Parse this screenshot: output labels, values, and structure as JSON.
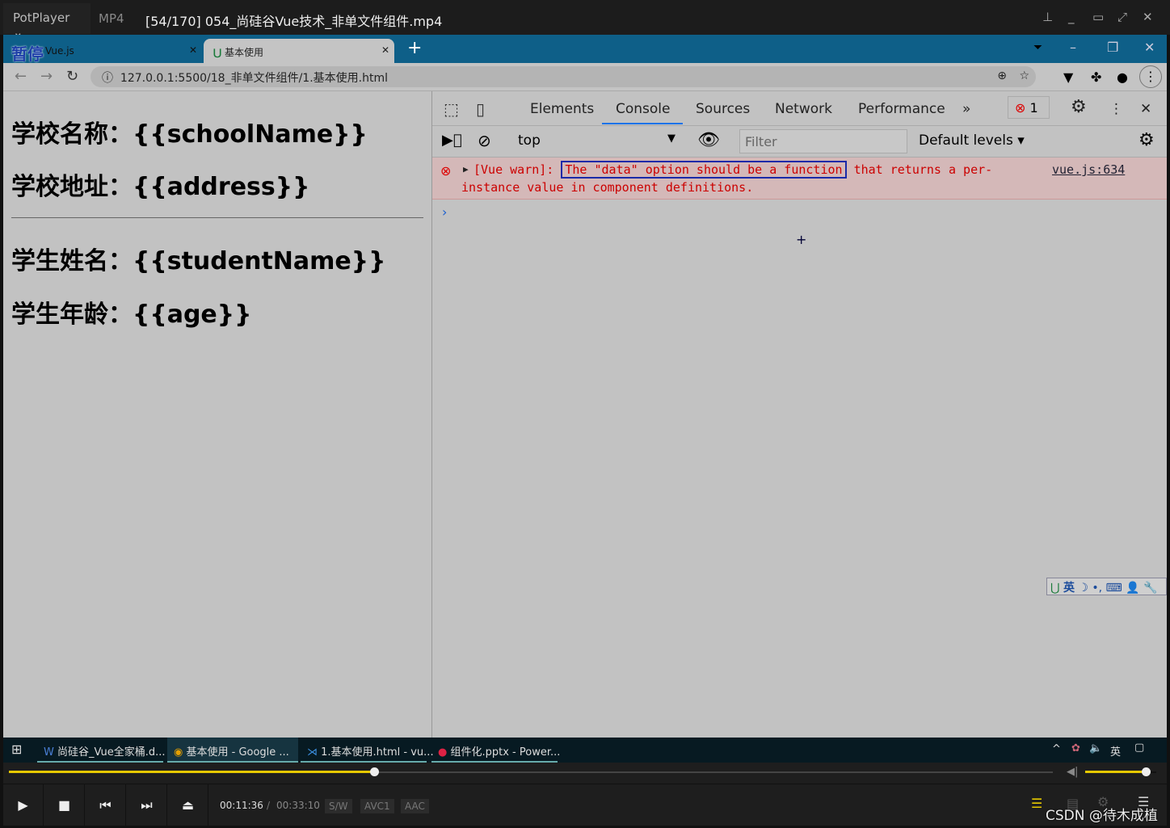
{
  "player": {
    "app": "PotPlayer",
    "format": "MP4",
    "title": "[54/170] 054_尚硅谷Vue技术_非单文件组件.mp4",
    "current_time": "00:11:36",
    "total_time": "00:33:10",
    "chips": [
      "S/W",
      "AVC1",
      "AAC"
    ],
    "progress_percent": 35,
    "volume_percent": 85,
    "watermark": "CSDN @待木成植",
    "paused_label": "暂停"
  },
  "browser": {
    "tabs": [
      {
        "label": "Vue.js"
      },
      {
        "label": "基本使用"
      }
    ],
    "url": "127.0.0.1:5500/18_非单文件组件/1.基本使用.html"
  },
  "page": {
    "lines": [
      "学校名称：{{schoolName}}",
      "学校地址：{{address}}",
      "学生姓名：{{studentName}}",
      "学生年龄：{{age}}"
    ]
  },
  "devtools": {
    "tabs": [
      "Elements",
      "Console",
      "Sources",
      "Network",
      "Performance"
    ],
    "active_tab": "Console",
    "error_count": "1",
    "context": "top",
    "filter_placeholder": "Filter",
    "levels": "Default levels",
    "message": {
      "prefix": "[Vue warn]:",
      "highlight": "The \"data\" option should be a function",
      "rest": "that returns a per-",
      "line2": "instance value in component definitions.",
      "source": "vue.js:634"
    }
  },
  "ime": {
    "lang": "英"
  },
  "taskbar": {
    "items": [
      "尚硅谷_Vue全家桶.d...",
      "基本使用 - Google ...",
      "1.基本使用.html - vu...",
      "组件化.pptx - Power..."
    ],
    "tray_lang": "英"
  }
}
